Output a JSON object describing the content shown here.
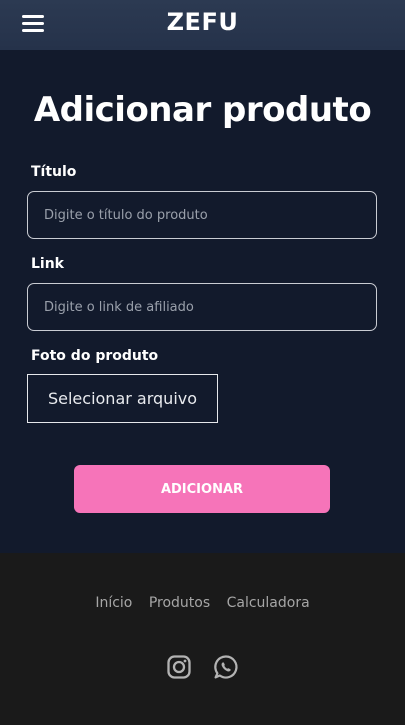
{
  "header": {
    "logo": "ZEFU",
    "menu_icon": "hamburger-menu-icon"
  },
  "form": {
    "title": "Adicionar produto",
    "title_label": "Título",
    "title_placeholder": "Digite o título do produto",
    "link_label": "Link",
    "link_placeholder": "Digite o link de afiliado",
    "photo_label": "Foto do produto",
    "file_button": "Selecionar arquivo",
    "submit_button": "ADICIONAR"
  },
  "footer": {
    "links": [
      "Início",
      "Produtos",
      "Calculadora"
    ],
    "social_icons": [
      "instagram-icon",
      "whatsapp-icon"
    ]
  },
  "colors": {
    "header_bg": "#2a374e",
    "main_bg": "#121a2c",
    "footer_bg": "#1a1a1a",
    "accent": "#f674b9",
    "footer_text": "#a6a6a6"
  }
}
